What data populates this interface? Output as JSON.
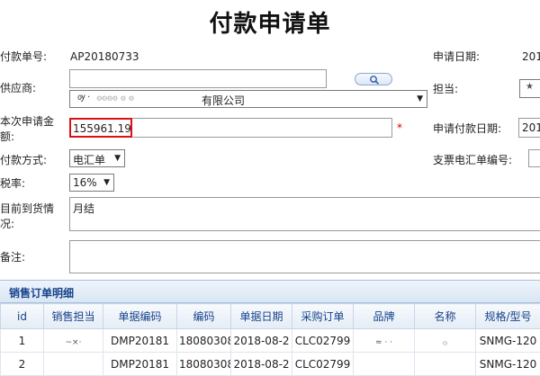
{
  "page": {
    "title": "付款申请单"
  },
  "form": {
    "payment_no_label": "付款单号:",
    "payment_no_value": "AP20180733",
    "apply_date_label": "申请日期:",
    "apply_date_value": "201",
    "supplier_label": "供应商:",
    "supplier_value": "有限公司",
    "handler_label": "担当:",
    "amount_label_1": "本次申请金",
    "amount_label_2": "额:",
    "amount_value": "155961.19",
    "required_mark": "*",
    "apply_pay_date_label": "申请付款日期:",
    "apply_pay_date_value": "201",
    "payment_method_label": "付款方式:",
    "payment_method_value": "电汇单",
    "bill_no_label": "支票电汇单编号:",
    "tax_rate_label": "税率:",
    "tax_rate_value": "16%",
    "arrival_label_1": "目前到货情",
    "arrival_label_2": "况:",
    "arrival_value": "月结",
    "remark_label": "备注:"
  },
  "order_detail": {
    "title": "销售订单明细",
    "columns": [
      "id",
      "销售担当",
      "单据编码",
      "编码",
      "单据日期",
      "采购订单",
      "品牌",
      "名称",
      "规格/型号"
    ],
    "rows": [
      [
        "1",
        "",
        "DMP20181",
        "18080308",
        "2018-08-2",
        "CLC02799",
        "",
        "",
        "SNMG-120"
      ],
      [
        "2",
        "",
        "DMP20181",
        "18080308",
        "2018-08-2",
        "CLC02799",
        "",
        "",
        "SNMG-120"
      ]
    ]
  },
  "icons": {
    "search": "search-icon",
    "dropdown": "chevron-down-icon"
  }
}
